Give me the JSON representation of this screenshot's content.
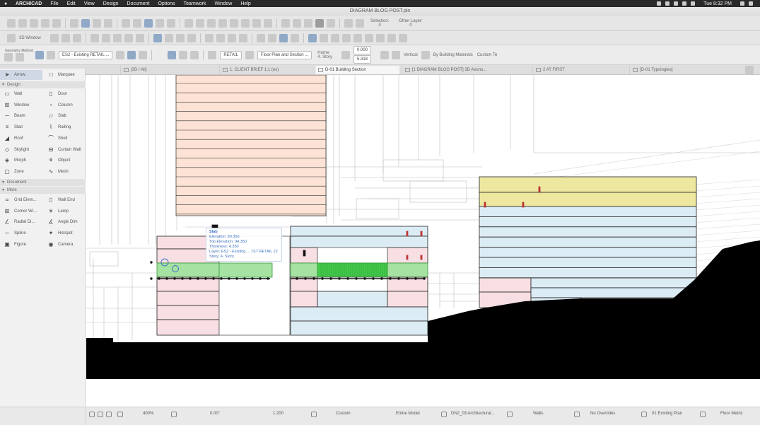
{
  "menubar": {
    "apple": "",
    "items": [
      "ARCHICAD",
      "File",
      "Edit",
      "View",
      "Design",
      "Document",
      "Options",
      "Teamwork",
      "Window",
      "Help"
    ],
    "clock": "Tue 8:32 PM"
  },
  "window": {
    "title": "DIAGRAM BLOG POST.pln"
  },
  "toolbar": {
    "selection_label": "Selection:",
    "other_layer_label": "Other Layer:",
    "selection_count": "0",
    "other_layer_count": "0",
    "view_label": "3D Window",
    "geometry_label": "Geometry Method",
    "layer_value": "ES2 - Existing RETAIL ...",
    "fill_value": "RETAIL",
    "story_value": "Floor Plan and Section ...",
    "home_label": "Home:",
    "story_label": "4. Story",
    "height_value": "0.000",
    "elev_value": "5.318",
    "vertical_label": "Vertical",
    "building_materials": "By Building Materials",
    "custom_label": "Custom Te"
  },
  "tabs": [
    {
      "label": "[3D / All]"
    },
    {
      "label": "1. CLIENT BRIEF 1:1 (ex)"
    },
    {
      "label": "D-01 Building Section"
    },
    {
      "label": "[1 DIAGRAM BLOG POST] 3D Axono..."
    },
    {
      "label": "2 AT FIRST"
    },
    {
      "label": "[D-01 Typologies]"
    }
  ],
  "toolbox": {
    "arrow": "Arrow",
    "marquee": "Marquee",
    "design_section": "Design",
    "document_section": "Document",
    "more_section": "More",
    "tools": [
      {
        "label": "Wall",
        "icon": "wall-icon",
        "glyph": "▭"
      },
      {
        "label": "Door",
        "icon": "door-icon",
        "glyph": "▯"
      },
      {
        "label": "Window",
        "icon": "window-icon",
        "glyph": "⊞"
      },
      {
        "label": "Column",
        "icon": "column-icon",
        "glyph": "▫"
      },
      {
        "label": "Beam",
        "icon": "beam-icon",
        "glyph": "─"
      },
      {
        "label": "Slab",
        "icon": "slab-icon",
        "glyph": "▱"
      },
      {
        "label": "Stair",
        "icon": "stair-icon",
        "glyph": "≡"
      },
      {
        "label": "Railing",
        "icon": "railing-icon",
        "glyph": "⌇"
      },
      {
        "label": "Roof",
        "icon": "roof-icon",
        "glyph": "◢"
      },
      {
        "label": "Shell",
        "icon": "shell-icon",
        "glyph": "⌒"
      },
      {
        "label": "Skylight",
        "icon": "skylight-icon",
        "glyph": "◇"
      },
      {
        "label": "Curtain Wall",
        "icon": "curtain-wall-icon",
        "glyph": "⊟"
      },
      {
        "label": "Morph",
        "icon": "morph-icon",
        "glyph": "◈"
      },
      {
        "label": "Object",
        "icon": "object-icon",
        "glyph": "⚘"
      },
      {
        "label": "Zone",
        "icon": "zone-icon",
        "glyph": "▢"
      },
      {
        "label": "Mesh",
        "icon": "mesh-icon",
        "glyph": "∿"
      }
    ],
    "more_tools": [
      {
        "label": "Grid Elem...",
        "icon": "grid-icon",
        "glyph": "⌗"
      },
      {
        "label": "Wall End",
        "icon": "wall-end-icon",
        "glyph": "▯"
      },
      {
        "label": "Corner Wi...",
        "icon": "corner-window-icon",
        "glyph": "⊞"
      },
      {
        "label": "Lamp",
        "icon": "lamp-icon",
        "glyph": "☀"
      },
      {
        "label": "Radial Di...",
        "icon": "radial-dim-icon",
        "glyph": "∠"
      },
      {
        "label": "Angle Dim",
        "icon": "angle-dim-icon",
        "glyph": "∡"
      },
      {
        "label": "Spline",
        "icon": "spline-icon",
        "glyph": "∽"
      },
      {
        "label": "Hotspot",
        "icon": "hotspot-icon",
        "glyph": "✦"
      },
      {
        "label": "Figure",
        "icon": "figure-icon",
        "glyph": "▣"
      },
      {
        "label": "Camera",
        "icon": "camera-icon",
        "glyph": "◉"
      }
    ]
  },
  "tooltip": {
    "lines": [
      "Slab",
      "Elevation: 90.350",
      "Top Elevation: 94.350",
      "Thickness: 4.350",
      "Layer: ES2 - Existing ... 1ST RETAIL 22",
      "Story: 4. Story"
    ]
  },
  "statusbar": {
    "zoom": "400%",
    "angle": "0.00°",
    "scale": "1:200",
    "structure": "Custom",
    "model": "Entire Model",
    "layer_combo": "DN2_03 Architectural...",
    "pen_set": "Walls",
    "overrides": "No Overrides",
    "renovation": "01 Existing Plan",
    "dimension": "Floor Metric"
  },
  "colors": {
    "pink": "#f8dfe4",
    "salmon": "#fde3d5",
    "blue": "#dcecf5",
    "yellow": "#ede7a0",
    "green": "#a6e2a1",
    "bright_green": "#43c94b",
    "terrain": "#000000"
  }
}
